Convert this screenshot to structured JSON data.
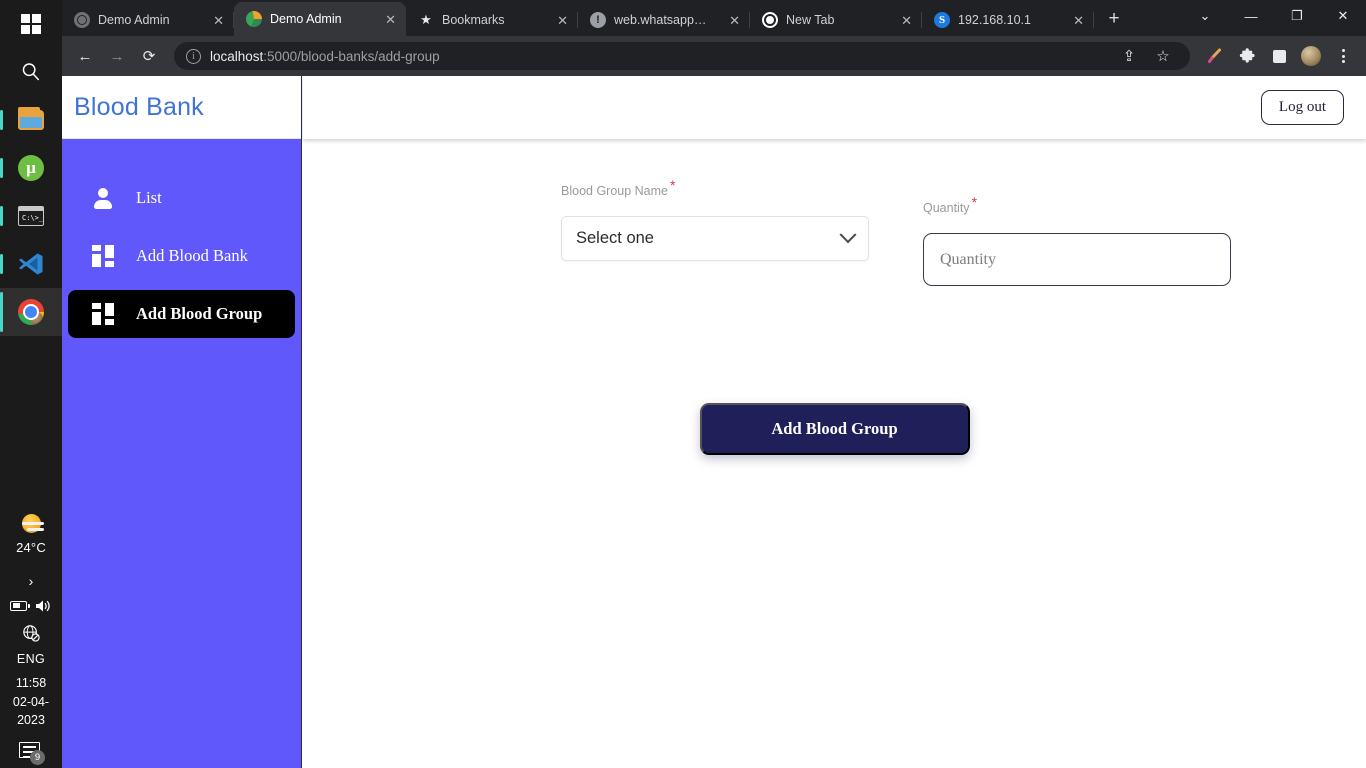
{
  "taskbar": {
    "apps": [
      {
        "name": "start-button",
        "icon": "windows-logo-icon"
      },
      {
        "name": "taskbar-search",
        "icon": "search-icon"
      },
      {
        "name": "file-explorer",
        "icon": "folder-icon"
      },
      {
        "name": "utorrent",
        "icon": "utorrent-icon",
        "glyph": "µ"
      },
      {
        "name": "terminal",
        "icon": "terminal-icon",
        "glyph": "C:\\>_"
      },
      {
        "name": "vs-code",
        "icon": "vscode-icon"
      },
      {
        "name": "google-chrome",
        "icon": "chrome-icon"
      }
    ],
    "tray": {
      "temperature": "24°C",
      "weather_icon": "sun-cloud-icon",
      "show_hidden_icons": "›",
      "battery_icon": "battery-icon",
      "volume_icon": "speaker-icon",
      "network_icon": "globe-no-internet-icon",
      "language": "ENG",
      "time": "11:58",
      "date": "02-04-2023",
      "notification_count": "9"
    }
  },
  "browser": {
    "tabs": [
      {
        "title": "Demo Admin",
        "favicon": "globe-icon",
        "active": false,
        "close": "✕"
      },
      {
        "title": "Demo Admin",
        "favicon": "demo-admin-icon",
        "active": true,
        "close": "✕"
      },
      {
        "title": "Bookmarks",
        "favicon": "star-icon",
        "active": false,
        "close": "✕"
      },
      {
        "title": "web.whatsapp.com",
        "favicon": "info-icon",
        "active": false,
        "close": "✕"
      },
      {
        "title": "New Tab",
        "favicon": "chrome-icon",
        "active": false,
        "close": "✕"
      },
      {
        "title": "192.168.10.1",
        "favicon": "s-icon",
        "active": false,
        "close": "✕"
      }
    ],
    "new_tab_label": "+",
    "window_controls": {
      "tab_search": "⌄",
      "minimize": "—",
      "maximize": "❐",
      "close": "✕"
    },
    "nav": {
      "back": "←",
      "forward": "→",
      "reload": "⟳",
      "info_icon": "ⓘ",
      "url_host": "localhost",
      "url_path": ":5000/blood-banks/add-group",
      "share": "⇪",
      "bookmark_star": "☆"
    },
    "toolbar_right": {
      "eyedropper": "eyedropper-icon",
      "extensions": "puzzle-icon",
      "side_panel": "side-panel-icon",
      "profile": "profile-avatar",
      "menu": "three-dot-menu"
    }
  },
  "app": {
    "brand": "Blood Bank",
    "sidebar": {
      "items": [
        {
          "label": "List",
          "icon": "person-icon",
          "active": false
        },
        {
          "label": "Add Blood Bank",
          "icon": "grid-icon",
          "active": false
        },
        {
          "label": "Add Blood Group",
          "icon": "grid-icon",
          "active": true
        }
      ]
    },
    "topbar": {
      "logout_label": "Log out"
    },
    "form": {
      "blood_group": {
        "label": "Blood Group Name",
        "required_mark": "*",
        "selected_value": "Select one",
        "chevron": "chevron-down-icon"
      },
      "quantity": {
        "label": "Quantity",
        "required_mark": "*",
        "placeholder": "Quantity",
        "value": ""
      },
      "submit_label": "Add Blood Group"
    },
    "colors": {
      "sidebar_purple": "#6058fb",
      "brand_blue": "#3f74d6",
      "active_item": "#000000",
      "submit_navy": "#1f2059",
      "required_red": "#d5384f"
    }
  }
}
